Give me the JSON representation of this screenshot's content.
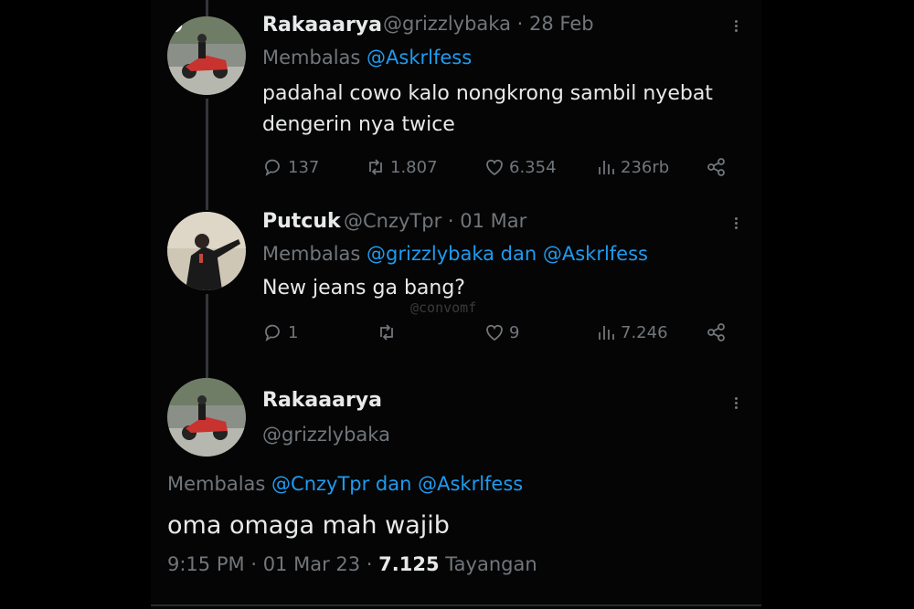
{
  "tweets": [
    {
      "name": "Rakaaarya",
      "handle": "@grizzlybaka",
      "separator": "·",
      "date": "28 Feb",
      "reply_prefix": "Membalas",
      "reply_mentions": "@Askrlfess",
      "text_line1": "padahal cowo kalo nongkrong sambil nyebat",
      "text_line2": "dengerin nya twice",
      "stats": {
        "replies": "137",
        "retweets": "1.807",
        "likes": "6.354",
        "views": "236rb"
      }
    },
    {
      "name": "Putcuk",
      "handle": "@CnzyTpr",
      "separator": "·",
      "date": "01 Mar",
      "reply_prefix": "Membalas",
      "reply_mentions": "@grizzlybaka dan @Askrlfess",
      "text_line1": "New jeans ga bang?",
      "stats": {
        "replies": "1",
        "retweets": "",
        "likes": "9",
        "views": "7.246"
      }
    }
  ],
  "focus": {
    "name": "Rakaaarya",
    "handle": "@grizzlybaka",
    "reply_prefix": "Membalas",
    "reply_mentions": "@CnzyTpr dan @Askrlfess",
    "text": "oma omaga mah wajib",
    "time": "9:15 PM",
    "separator": "·",
    "date": "01 Mar 23",
    "separator2": "·",
    "views": "7.125",
    "views_label": "Tayangan"
  },
  "watermark": "@convomf",
  "colors": {
    "background": "#000000",
    "text": "#e7e9ea",
    "muted": "#71767b",
    "accent": "#1d9bf0"
  },
  "icons": [
    "reply-icon",
    "retweet-icon",
    "like-icon",
    "views-icon",
    "share-icon",
    "more-icon"
  ]
}
